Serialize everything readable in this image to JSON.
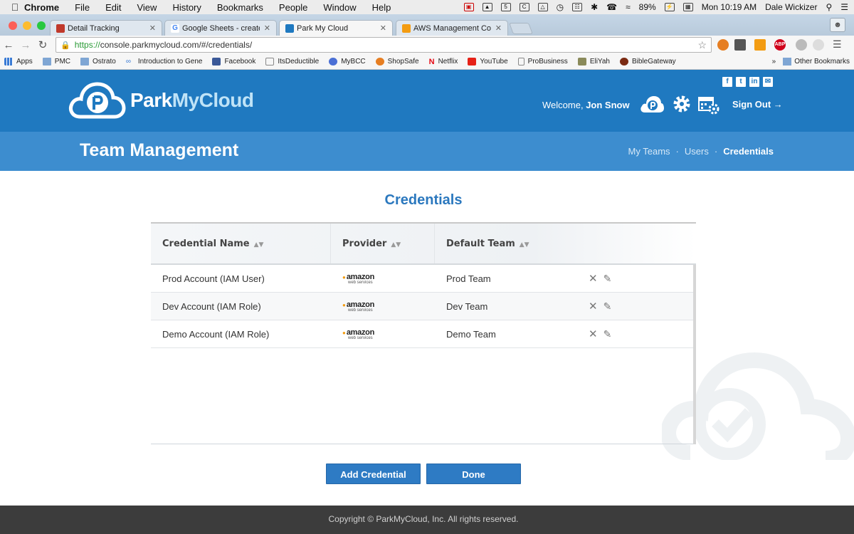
{
  "menubar": {
    "app": "Chrome",
    "items": [
      "File",
      "Edit",
      "View",
      "History",
      "Bookmarks",
      "People",
      "Window",
      "Help"
    ],
    "battery": "89%",
    "clock": "Mon 10:19 AM",
    "user": "Dale Wickizer"
  },
  "tabs": [
    {
      "title": "Detail Tracking",
      "color": "#c0392b"
    },
    {
      "title": "Google Sheets - create and",
      "color": "#34a853"
    },
    {
      "title": "Park My Cloud",
      "color": "#1f79c0"
    },
    {
      "title": "AWS Management Console",
      "color": "#f39c12"
    }
  ],
  "omnibox": {
    "scheme": "https://",
    "rest": "console.parkmycloud.com/#/credentials/"
  },
  "bookmarks": {
    "items": [
      "Apps",
      "PMC",
      "Ostrato",
      "Introduction to Gene",
      "Facebook",
      "ItsDeductible",
      "MyBCC",
      "ShopSafe",
      "Netflix",
      "YouTube",
      "ProBusiness",
      "EliYah",
      "BibleGateway"
    ],
    "other": "Other Bookmarks"
  },
  "header": {
    "logo_park": "Park",
    "logo_mycloud": "MyCloud",
    "welcome_prefix": "Welcome,",
    "user_name": "Jon Snow",
    "sign_out": "Sign Out →",
    "social": [
      "f",
      "t",
      "in",
      "✉"
    ]
  },
  "subheader": {
    "title": "Team Management",
    "nav": [
      "My Teams",
      "Users",
      "Credentials"
    ]
  },
  "main": {
    "title": "Credentials",
    "columns": [
      "Credential Name",
      "Provider",
      "Default Team"
    ],
    "rows": [
      {
        "name": "Prod Account (IAM User)",
        "team": "Prod Team"
      },
      {
        "name": "Dev Account (IAM Role)",
        "team": "Dev Team"
      },
      {
        "name": "Demo Account (IAM Role)",
        "team": "Demo Team"
      }
    ],
    "provider_logo_text": "amazon",
    "provider_logo_sub": "web services",
    "add_button": "Add Credential",
    "done_button": "Done"
  },
  "footer": {
    "copyright": "Copyright © ParkMyCloud, Inc. All rights reserved."
  },
  "colors": {
    "header_blue": "#1f79c0",
    "subheader_blue": "#3d8dcf",
    "button_blue": "#2e7bc4",
    "title_blue": "#2b78be",
    "footer_dark": "#3c3c3c"
  }
}
